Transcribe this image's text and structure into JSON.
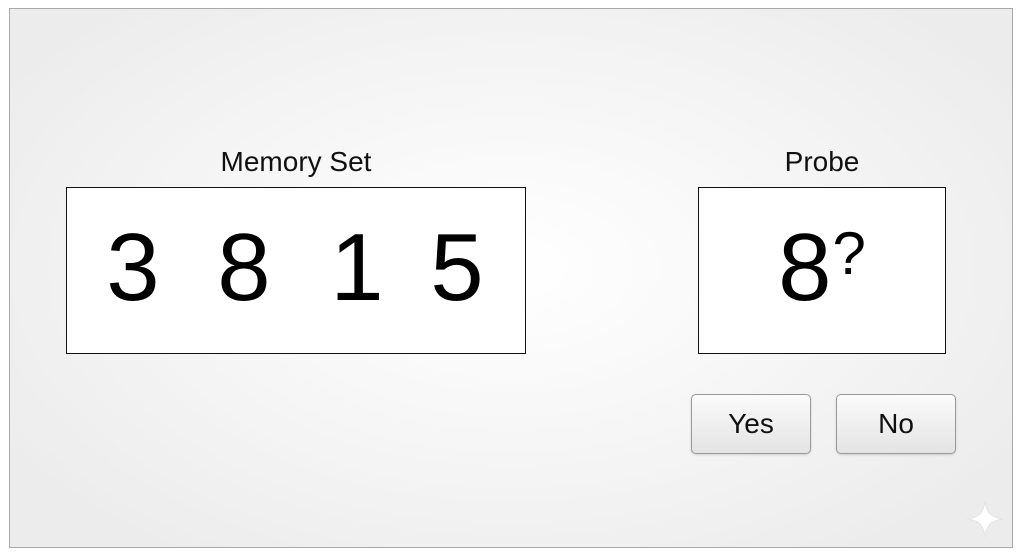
{
  "memory": {
    "label": "Memory Set",
    "digits": [
      "3",
      "8",
      "1",
      "5"
    ]
  },
  "probe": {
    "label": "Probe",
    "digit": "8",
    "mark": "?"
  },
  "buttons": {
    "yes_label": "Yes",
    "no_label": "No"
  },
  "icons": {
    "watermark": "sparkle-icon"
  }
}
